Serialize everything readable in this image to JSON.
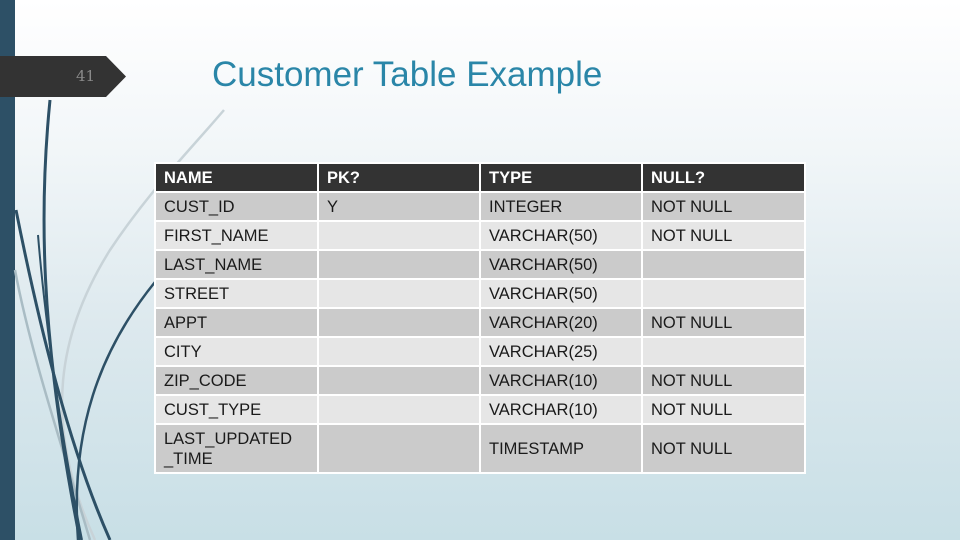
{
  "slide": {
    "number": "41",
    "title": "Customer Table Example"
  },
  "table": {
    "headers": [
      "NAME",
      "PK?",
      "TYPE",
      "NULL?"
    ],
    "rows": [
      [
        "CUST_ID",
        "Y",
        "INTEGER",
        "NOT NULL"
      ],
      [
        "FIRST_NAME",
        "",
        "VARCHAR(50)",
        "NOT NULL"
      ],
      [
        "LAST_NAME",
        "",
        "VARCHAR(50)",
        ""
      ],
      [
        "STREET",
        "",
        "VARCHAR(50)",
        ""
      ],
      [
        "APPT",
        "",
        "VARCHAR(20)",
        "NOT NULL"
      ],
      [
        "CITY",
        "",
        "VARCHAR(25)",
        ""
      ],
      [
        "ZIP_CODE",
        "",
        "VARCHAR(10)",
        "NOT NULL"
      ],
      [
        "CUST_TYPE",
        "",
        "VARCHAR(10)",
        "NOT NULL"
      ],
      [
        "LAST_UPDATED\n_TIME",
        "",
        "TIMESTAMP",
        "NOT NULL"
      ]
    ]
  },
  "colors": {
    "title": "#2a86a8",
    "header_bg": "#333333",
    "row_odd": "#cbcbcb",
    "row_even": "#e6e6e6",
    "accent_bar": "#2d5066"
  }
}
